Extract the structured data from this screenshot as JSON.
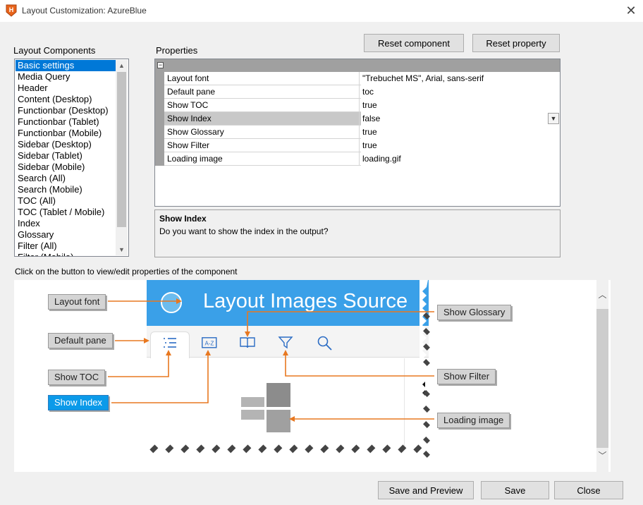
{
  "window": {
    "title": "Layout Customization: AzureBlue",
    "close_glyph": "✕"
  },
  "toolbar": {
    "reset_component": "Reset component",
    "reset_property": "Reset property"
  },
  "components": {
    "label": "Layout Components",
    "items": [
      "Basic settings",
      "Media Query",
      "Header",
      "Content (Desktop)",
      "Functionbar (Desktop)",
      "Functionbar (Tablet)",
      "Functionbar (Mobile)",
      "Sidebar (Desktop)",
      "Sidebar (Tablet)",
      "Sidebar (Mobile)",
      "Search (All)",
      "Search (Mobile)",
      "TOC (All)",
      "TOC (Tablet / Mobile)",
      "Index",
      "Glossary",
      "Filter (All)",
      "Filter (Mobile)"
    ],
    "selected_index": 0
  },
  "properties": {
    "label": "Properties",
    "rows": [
      {
        "name": "Layout font",
        "value": "\"Trebuchet MS\", Arial, sans-serif"
      },
      {
        "name": "Default pane",
        "value": "toc"
      },
      {
        "name": "Show TOC",
        "value": "true"
      },
      {
        "name": "Show Index",
        "value": "false"
      },
      {
        "name": "Show Glossary",
        "value": "true"
      },
      {
        "name": "Show Filter",
        "value": "true"
      },
      {
        "name": "Loading image",
        "value": "loading.gif"
      }
    ],
    "selected_index": 3
  },
  "description": {
    "title": "Show Index",
    "text": "Do you want to show the index in the output?"
  },
  "preview": {
    "hint": "Click on the button to view/edit properties of the component",
    "header_title": "Layout Images Source",
    "callouts": {
      "layout_font": "Layout font",
      "default_pane": "Default pane",
      "show_toc": "Show TOC",
      "show_index": "Show Index",
      "show_glossary": "Show Glossary",
      "show_filter": "Show Filter",
      "loading_image": "Loading image"
    },
    "tab_icons": [
      "toc-list-icon",
      "index-az-icon",
      "glossary-book-icon",
      "filter-icon",
      "search-icon"
    ],
    "colors": {
      "header": "#3aa0e8",
      "callout_line": "#e87820",
      "active_callout": "#0b9ae9"
    }
  },
  "footer": {
    "save_preview": "Save and Preview",
    "save": "Save",
    "close": "Close"
  }
}
